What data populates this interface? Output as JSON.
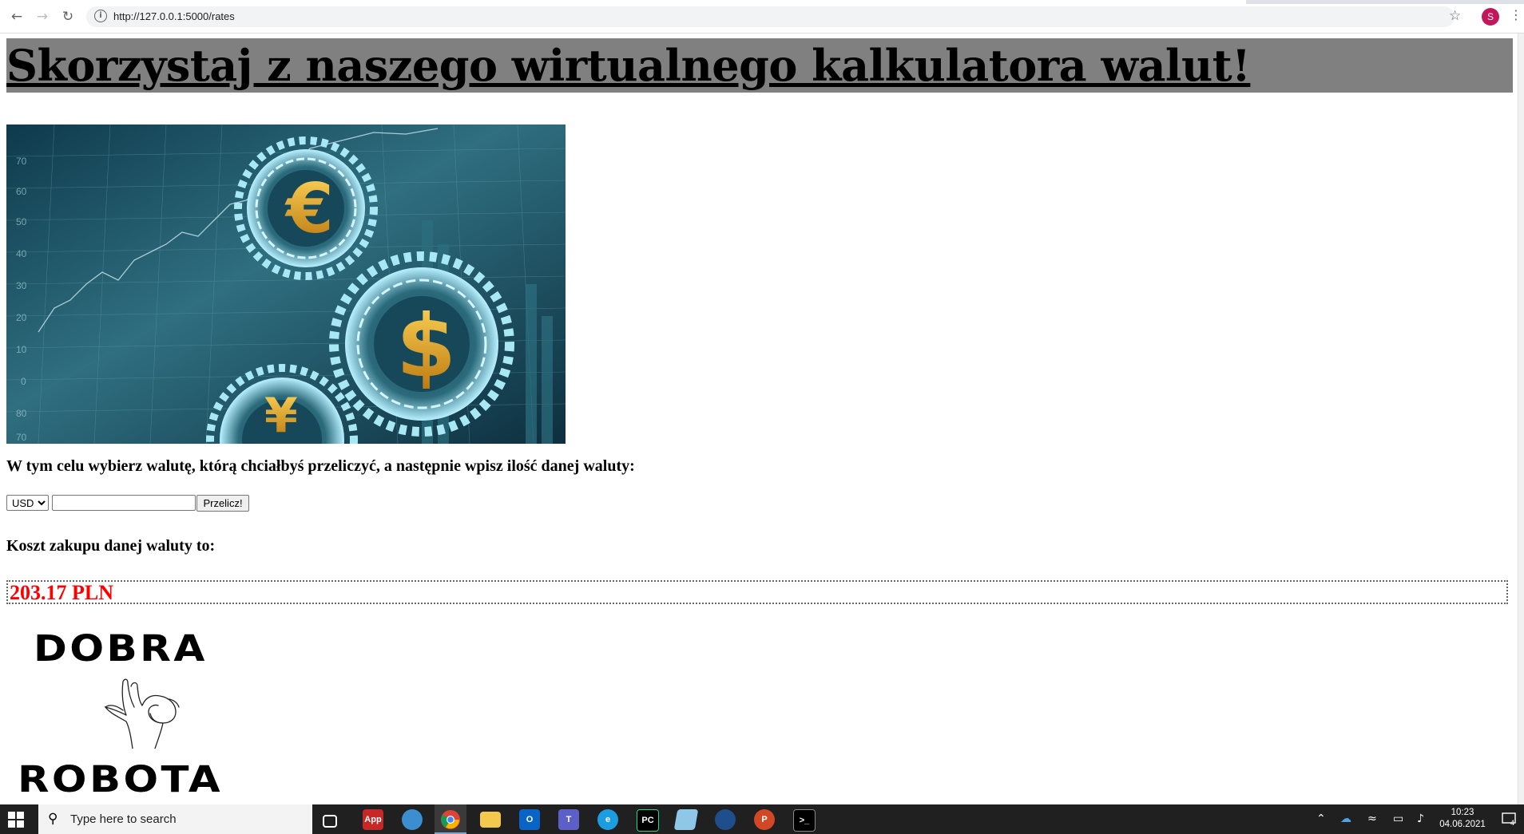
{
  "browser": {
    "url": "http://127.0.0.1:5000/rates",
    "back_icon": "arrow-left-icon",
    "forward_icon": "arrow-right-icon",
    "reload_icon": "reload-icon",
    "profile_initial": "S",
    "profile_color": "#c2185b"
  },
  "page": {
    "title": "Skorzystaj z naszego wirtualnego kalkulatora walut!",
    "title_bg": "#808080",
    "banner_image": "currency-gears-banner",
    "instruction": "W tym celu wybierz walutę, którą chciałbyś przeliczyć, a następnie wpisz ilość danej waluty:",
    "currency_select": {
      "selected": "USD",
      "options": [
        "USD"
      ]
    },
    "amount_input": {
      "value": "",
      "placeholder": ""
    },
    "convert_button": "Przelicz!",
    "cost_label": "Koszt zakupu danej waluty to:",
    "result": "203.17 PLN",
    "result_color": "#ff0000",
    "footer_image": {
      "line1": "DOBRA",
      "line2": "ROBOTA",
      "icon": "ok-hand-icon"
    }
  },
  "taskbar": {
    "search_placeholder": "Type here to search",
    "apps": [
      "task-view",
      "app",
      "store",
      "chrome",
      "file-explorer",
      "outlook",
      "teams",
      "edge",
      "pycharm",
      "notepad",
      "app-2",
      "powerpoint",
      "terminal"
    ],
    "time": "10:23",
    "date": "04.06.2021",
    "notifications": "4"
  }
}
